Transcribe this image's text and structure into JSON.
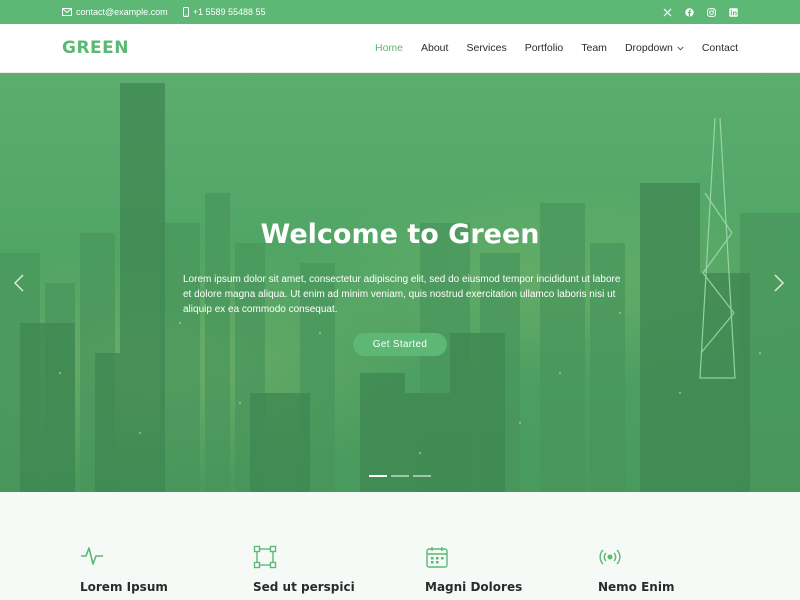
{
  "topbar": {
    "email": "contact@example.com",
    "phone": "+1 5589 55488 55",
    "social_icons": [
      "x-icon",
      "facebook-icon",
      "instagram-icon",
      "linkedin-icon"
    ]
  },
  "header": {
    "logo": "GREEN",
    "nav": [
      {
        "label": "Home",
        "active": true
      },
      {
        "label": "About"
      },
      {
        "label": "Services"
      },
      {
        "label": "Portfolio"
      },
      {
        "label": "Team"
      },
      {
        "label": "Dropdown",
        "has_dropdown": true
      },
      {
        "label": "Contact"
      }
    ]
  },
  "hero": {
    "title": "Welcome to Green",
    "text": "Lorem ipsum dolor sit amet, consectetur adipiscing elit, sed do eiusmod tempor incididunt ut labore et dolore magna aliqua. Ut enim ad minim veniam, quis nostrud exercitation ullamco laboris nisi ut aliquip ex ea commodo consequat.",
    "button": "Get Started",
    "slides": 3,
    "active_slide": 1
  },
  "features": [
    {
      "icon": "activity-icon",
      "title": "Lorem Ipsum"
    },
    {
      "icon": "bounding-box-icon",
      "title": "Sed ut perspici"
    },
    {
      "icon": "calendar-icon",
      "title": "Magni Dolores"
    },
    {
      "icon": "broadcast-icon",
      "title": "Nemo Enim"
    }
  ],
  "colors": {
    "accent": "#5cb874",
    "text": "#2b2b2b"
  }
}
